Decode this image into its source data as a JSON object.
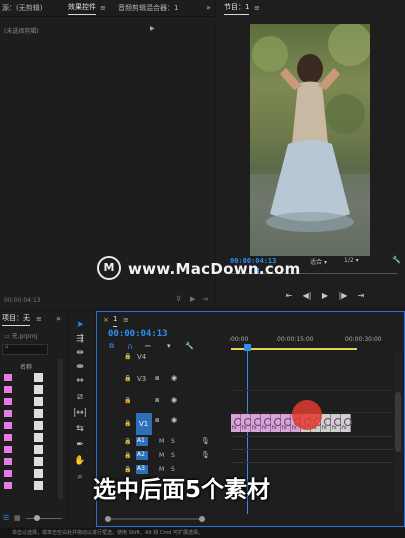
{
  "source_panel": {
    "tab_source": "源：(无剪辑)",
    "tab_effect_controls": "效果控件",
    "tab_audio_mixer": "音频剪辑混合器：1",
    "no_clip_text": "(未选择剪辑)",
    "timecode": "00:00:04:13"
  },
  "program_monitor": {
    "tab_label": "节目：1",
    "timecode": "00:00:04:13",
    "fit_label": "适合",
    "resolution": "1/2"
  },
  "watermark": "www.MacDown.com",
  "project_panel": {
    "tab_label": "项目：无",
    "file_name": "无.prproj",
    "column_name": "名称"
  },
  "timeline": {
    "tab_label": "1",
    "timecode": "00:00:04:13",
    "ruler_labels": [
      ":00:00",
      "00:00:15:00",
      "00:00:30:00"
    ],
    "tracks": {
      "v4": "V4",
      "v3": "V3",
      "v1_source": "V1",
      "v1": "V1",
      "a1_source": "A1",
      "a1": "A1",
      "a2": "A2",
      "a3": "A3",
      "m": "M",
      "s": "S"
    },
    "clip_label": "fx",
    "clips": [
      {
        "color": "pink"
      },
      {
        "color": "pink"
      },
      {
        "color": "pink"
      },
      {
        "color": "pink"
      },
      {
        "color": "pink"
      },
      {
        "color": "pink"
      },
      {
        "color": "pink"
      },
      {
        "color": "gray"
      },
      {
        "color": "gray"
      },
      {
        "color": "gray"
      },
      {
        "color": "gray"
      },
      {
        "color": "gray"
      }
    ]
  },
  "caption": "选中后面5个素材",
  "status_bar": "单击以选择，或单击空白处并拖动以进行框选。使用 Shift、Alt 和 Cmd 可扩展选择。",
  "colors": {
    "accent_blue": "#2e8ff0",
    "clip_pink": "#d8a3d8",
    "clip_gray": "#cfcfcf",
    "playhead_red": "#e23a2e"
  }
}
